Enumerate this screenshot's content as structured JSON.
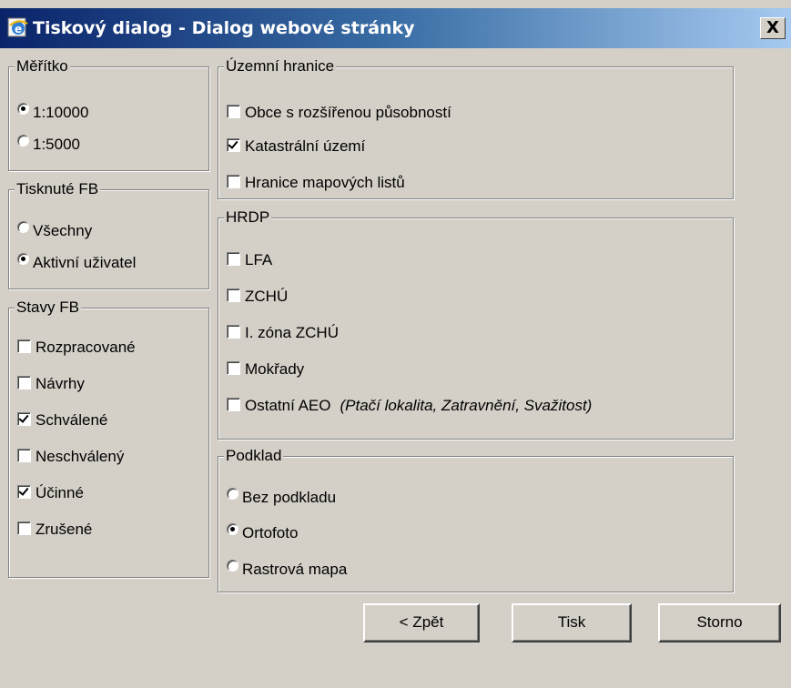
{
  "window": {
    "title": "Tiskový dialog - Dialog webové stránky",
    "close_label": "X"
  },
  "scale": {
    "legend": "Měřítko",
    "options": [
      {
        "label": "1:10000",
        "selected": true
      },
      {
        "label": "1:5000",
        "selected": false
      }
    ]
  },
  "printed_fb": {
    "legend": "Tisknuté FB",
    "options": [
      {
        "label": "Všechny",
        "selected": false
      },
      {
        "label": "Aktivní uživatel",
        "selected": true
      }
    ]
  },
  "fb_states": {
    "legend": "Stavy FB",
    "items": [
      {
        "label": "Rozpracované",
        "checked": false
      },
      {
        "label": "Návrhy",
        "checked": false
      },
      {
        "label": "Schválené",
        "checked": true
      },
      {
        "label": "Neschválený",
        "checked": false
      },
      {
        "label": "Účinné",
        "checked": true
      },
      {
        "label": "Zrušené",
        "checked": false
      }
    ]
  },
  "boundaries": {
    "legend": "Územní hranice",
    "items": [
      {
        "label": "Obce s rozšířenou působností",
        "checked": false
      },
      {
        "label": "Katastrální území",
        "checked": true
      },
      {
        "label": "Hranice mapových listů",
        "checked": false
      }
    ]
  },
  "hrdp": {
    "legend": "HRDP",
    "items": [
      {
        "label": "LFA",
        "checked": false
      },
      {
        "label": "ZCHÚ",
        "checked": false
      },
      {
        "label": "I. zóna ZCHÚ",
        "checked": false
      },
      {
        "label": "Mokřady",
        "checked": false
      },
      {
        "label": "Ostatní AEO",
        "checked": false,
        "note": "(Ptačí lokalita, Zatravnění, Svažitost)"
      }
    ]
  },
  "background_layer": {
    "legend": "Podklad",
    "options": [
      {
        "label": "Bez podkladu",
        "selected": false
      },
      {
        "label": "Ortofoto",
        "selected": true
      },
      {
        "label": "Rastrová mapa",
        "selected": false
      }
    ]
  },
  "buttons": {
    "back": "< Zpět",
    "print": "Tisk",
    "cancel": "Storno"
  },
  "colors": {
    "dialog_face": "#d4d0c8",
    "title_gradient_start": "#0a246a",
    "title_gradient_end": "#a6caf0"
  }
}
